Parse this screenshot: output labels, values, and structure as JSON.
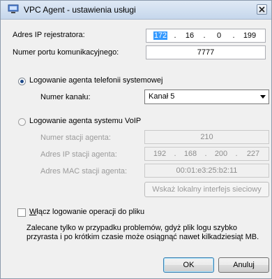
{
  "window": {
    "title": "VPC Agent - ustawienia usługi"
  },
  "recorder": {
    "ip_label": "Adres IP rejestratora:",
    "ip": [
      "172",
      "16",
      "0",
      "199"
    ],
    "port_label": "Numer portu komunikacyjnego:",
    "port": "7777"
  },
  "system_telephony": {
    "radio_label": "Logowanie agenta telefonii systemowej",
    "selected": true,
    "channel_label": "Numer kanału:",
    "channel_value": "Kanał 5"
  },
  "voip": {
    "radio_label": "Logowanie agenta systemu VoIP",
    "selected": false,
    "station_label": "Numer stacji agenta:",
    "station_value": "210",
    "ip_label": "Adres IP stacji agenta:",
    "ip": [
      "192",
      "168",
      "200",
      "227"
    ],
    "mac_label": "Adres MAC stacji agenta:",
    "mac_value": "00:01:e3:25:b2:11",
    "show_iface_button": "Wskaż lokalny interfejs sieciowy"
  },
  "logging": {
    "checkbox_prefix": "W",
    "checkbox_rest": "łącz logowanie operacji do pliku",
    "checked": false,
    "note_line1": "Zalecane tylko w przypadku problemów, gdyż plik logu szybko",
    "note_line2": "przyrasta i po krótkim czasie może osiągnąć nawet kilkadziesiąt MB."
  },
  "buttons": {
    "ok": "OK",
    "cancel": "Anuluj"
  },
  "colors": {
    "selection": "#3399ff",
    "radio_dot": "#1e4a8a"
  }
}
